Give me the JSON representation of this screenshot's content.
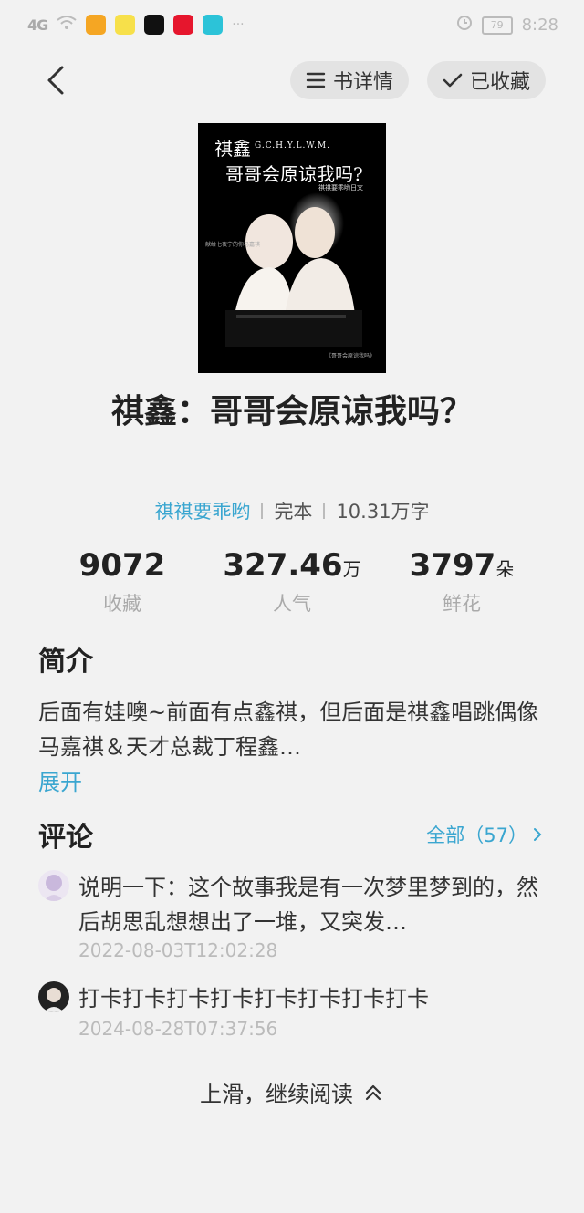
{
  "status_bar": {
    "signal": "4G",
    "time": "8:28",
    "battery": "79"
  },
  "nav": {
    "detail_label": "书详情",
    "favorited_label": "已收藏"
  },
  "cover": {
    "title_line1": "祺鑫",
    "title_line1_sub": "G.C.H.Y.L.W.M.",
    "title_line2": "哥哥会原谅我吗?",
    "tagline": "祺祺要乖哟日文",
    "side_text": "献给七夜宁的你马嘉祺",
    "bottom_text": "《哥哥会原谅我吗》"
  },
  "book": {
    "title": "祺鑫：哥哥会原谅我吗？",
    "author": "祺祺要乖哟",
    "status": "完本",
    "word_count": "10.31万字"
  },
  "stats": [
    {
      "value": "9072",
      "unit": "",
      "label": "收藏"
    },
    {
      "value": "327.46",
      "unit": "万",
      "label": "人气"
    },
    {
      "value": "3797",
      "unit": "朵",
      "label": "鲜花"
    }
  ],
  "intro": {
    "heading": "简介",
    "text": "后面有娃噢~前面有点鑫祺，但后面是祺鑫唱跳偶像马嘉祺＆天才总裁丁程鑫…",
    "expand_label": "展开"
  },
  "comments": {
    "heading": "评论",
    "all_label": "全部（57）",
    "items": [
      {
        "text": "说明一下：这个故事我是有一次梦里梦到的，然后胡思乱想想出了一堆，又突发…",
        "time": "2022-08-03T12:02:28"
      },
      {
        "text": "打卡打卡打卡打卡打卡打卡打卡打卡",
        "time": "2024-08-28T07:37:56"
      }
    ]
  },
  "footer": {
    "swipe_label": "上滑，继续阅读"
  },
  "colors": {
    "accent": "#3aa6d0",
    "background": "#f2f2f2"
  }
}
